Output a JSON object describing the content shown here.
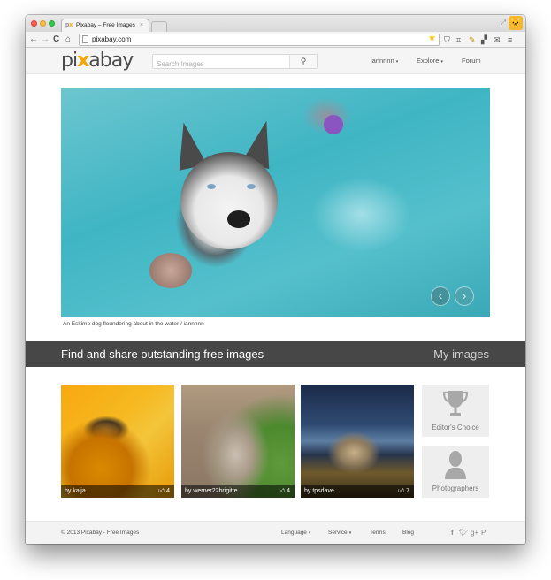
{
  "browser": {
    "tab_title": "Pixabay – Free Images",
    "tab_favicon": "px",
    "tab_close": "×",
    "url": "pixabay.com",
    "nav": {
      "back": "←",
      "forward": "→",
      "reload": "C",
      "home": "⌂"
    },
    "icons": [
      "star-icon",
      "pocket-icon",
      "screenshot-icon",
      "css-icon",
      "extension-icon",
      "gmail-icon",
      "menu-icon"
    ]
  },
  "header": {
    "logo_pre": "pi",
    "logo_x": "x",
    "logo_post": "abay",
    "search_placeholder": "Search Images",
    "search_button_icon": "search-icon",
    "nav": [
      {
        "label": "iannnnn",
        "has_dropdown": true
      },
      {
        "label": "Explore",
        "has_dropdown": true
      },
      {
        "label": "Forum",
        "has_dropdown": false
      }
    ]
  },
  "hero": {
    "caption": "An Eskimo dog floundering about in the water  / iannnnn",
    "prev": "‹",
    "next": "›"
  },
  "banner": {
    "title": "Find and share outstanding free images",
    "link": "My images"
  },
  "thumbnails": [
    {
      "author": "by kalja",
      "likes": "4"
    },
    {
      "author": "by werner22brigitte",
      "likes": "4"
    },
    {
      "author": "by tpsdave",
      "likes": "7"
    }
  ],
  "side_boxes": [
    {
      "label": "Editor's Choice",
      "icon": "trophy-icon"
    },
    {
      "label": "Photographers",
      "icon": "person-icon"
    }
  ],
  "footer": {
    "copyright": "© 2013 Pixabay - Free Images",
    "links": [
      {
        "label": "Language",
        "has_dropdown": true
      },
      {
        "label": "Service",
        "has_dropdown": true
      },
      {
        "label": "Terms",
        "has_dropdown": false
      },
      {
        "label": "Blog",
        "has_dropdown": false
      }
    ],
    "social": {
      "facebook": "f",
      "twitter": "t",
      "googleplus": "g+",
      "pinterest": "P"
    }
  },
  "like_glyph": "👍",
  "caret_glyph": "▾"
}
